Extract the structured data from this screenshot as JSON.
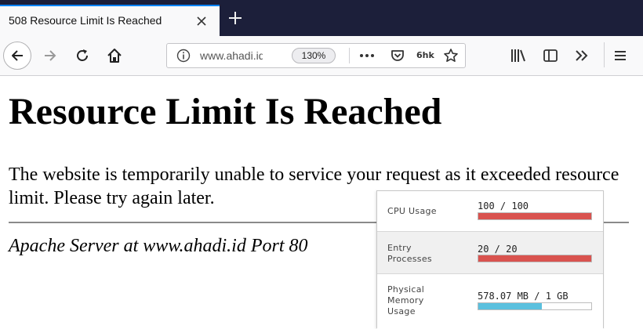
{
  "browser": {
    "tab_title": "508 Resource Limit Is Reached",
    "url_text": "www.ahadi.id",
    "zoom_label": "130%",
    "extension_label": "6hk",
    "icons": [
      "close-icon",
      "plus-icon",
      "back-arrow-icon",
      "forward-arrow-icon",
      "reload-icon",
      "home-icon",
      "info-icon",
      "more-icon",
      "pocket-icon",
      "star-icon",
      "library-icon",
      "sidebar-icon",
      "overflow-icon",
      "menu-icon"
    ]
  },
  "page": {
    "heading": "Resource Limit Is Reached",
    "message": "The website is temporarily unable to service your request as it exceeded resource limit. Please try again later.",
    "address": "Apache Server at www.ahadi.id Port 80"
  },
  "usage_panel": {
    "rows": [
      {
        "label": "CPU Usage",
        "value": "100 / 100",
        "fraction": 1.0,
        "color": "#d9534f"
      },
      {
        "label": "Entry\nProcesses",
        "value": "20 / 20",
        "fraction": 1.0,
        "color": "#d9534f"
      },
      {
        "label": "Physical\nMemory\nUsage",
        "value": "578.07 MB / 1 GB",
        "fraction": 0.5645,
        "color": "#5bc0de"
      }
    ]
  },
  "colors": {
    "tabstrip": "#1c1f3a",
    "active_tab_accent": "#0a84ff",
    "toolbar": "#f9f9fa"
  }
}
